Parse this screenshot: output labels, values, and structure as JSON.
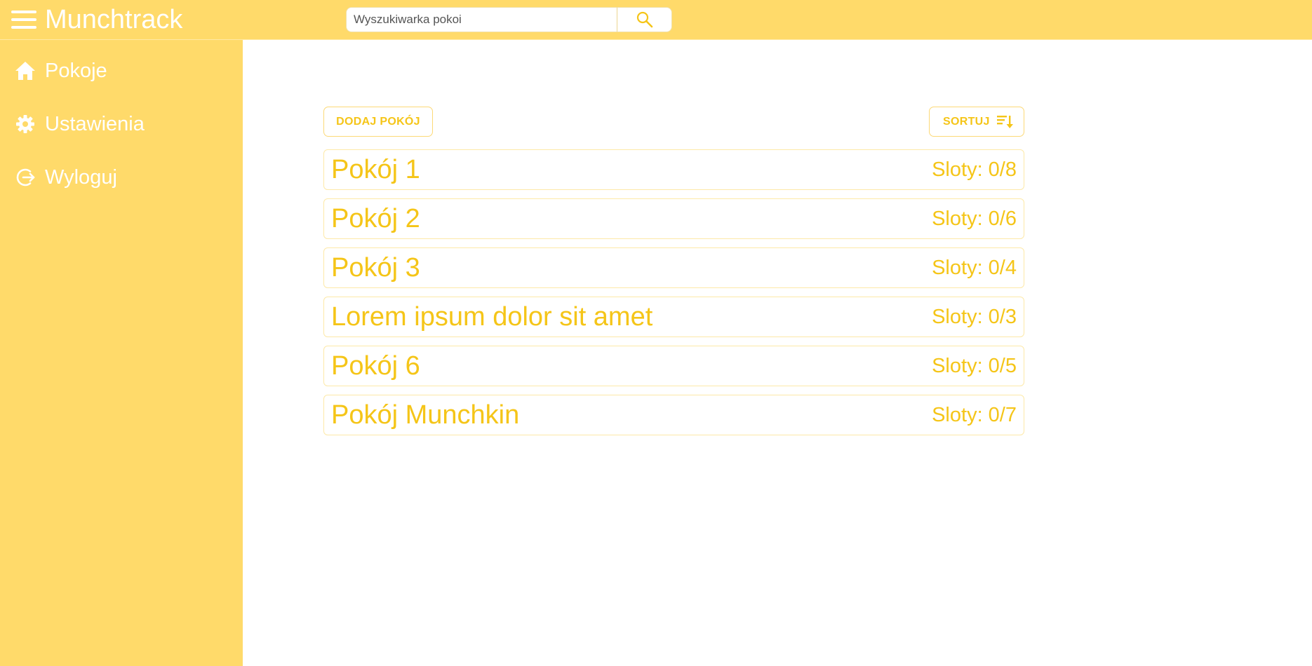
{
  "header": {
    "title": "Munchtrack",
    "search_placeholder": "Wyszukiwarka pokoi"
  },
  "sidebar": {
    "items": [
      {
        "label": "Pokoje",
        "icon": "home-icon"
      },
      {
        "label": "Ustawienia",
        "icon": "gear-icon"
      },
      {
        "label": "Wyloguj",
        "icon": "logout-icon"
      }
    ]
  },
  "toolbar": {
    "add_label": "DODAJ POKÓJ",
    "sort_label": "SORTUJ",
    "sort_icon": "sort-icon"
  },
  "rooms": [
    {
      "name": "Pokój 1",
      "slots": "Sloty: 0/8"
    },
    {
      "name": "Pokój 2",
      "slots": "Sloty: 0/6"
    },
    {
      "name": "Pokój 3",
      "slots": "Sloty: 0/4"
    },
    {
      "name": "Lorem ipsum dolor sit amet",
      "slots": "Sloty: 0/3"
    },
    {
      "name": "Pokój 6",
      "slots": "Sloty: 0/5"
    },
    {
      "name": "Pokój Munchkin",
      "slots": "Sloty: 0/7"
    }
  ],
  "colors": {
    "accent": "#ffda6a",
    "text_accent": "#f5c518",
    "border": "#fde9a8"
  }
}
